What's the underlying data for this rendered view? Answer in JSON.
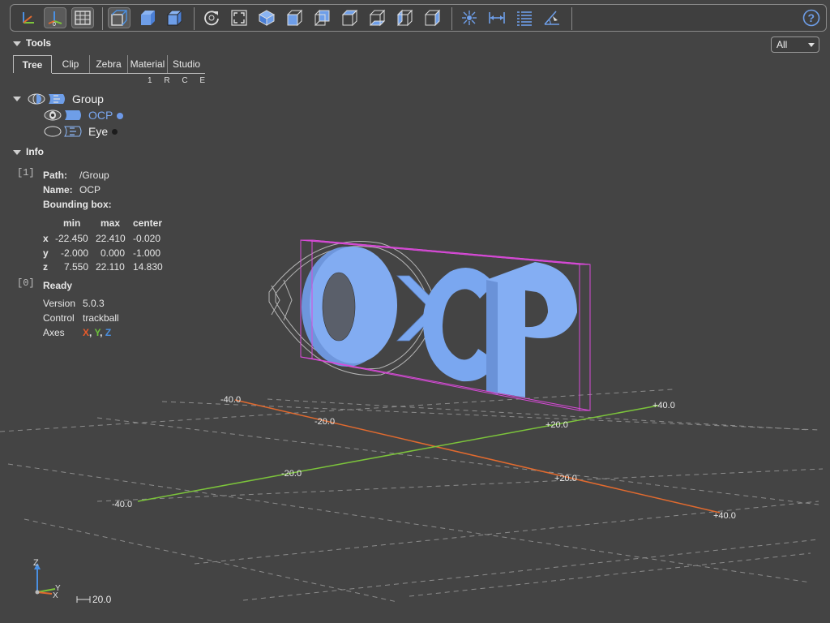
{
  "toolbar": {
    "buttons": [
      {
        "icon": "axes-icon",
        "active": false
      },
      {
        "icon": "axes-origin-icon",
        "active": true
      },
      {
        "icon": "grid-icon",
        "active": true
      },
      {
        "icon": "perspective-icon",
        "active": true
      },
      {
        "icon": "transparent-icon",
        "active": false
      },
      {
        "icon": "black-edges-icon",
        "active": false
      },
      {
        "icon": "reset-view-icon",
        "active": false
      },
      {
        "icon": "resize-icon",
        "active": false
      },
      {
        "icon": "view-iso-icon",
        "active": false
      },
      {
        "icon": "view-front-icon",
        "active": false
      },
      {
        "icon": "view-rear-icon",
        "active": false
      },
      {
        "icon": "view-top-icon",
        "active": false
      },
      {
        "icon": "view-bottom-icon",
        "active": false
      },
      {
        "icon": "view-left-icon",
        "active": false
      },
      {
        "icon": "view-right-icon",
        "active": false
      },
      {
        "icon": "explode-icon",
        "active": false
      },
      {
        "icon": "distance-measure-icon",
        "active": false
      },
      {
        "icon": "properties-icon",
        "active": false
      },
      {
        "icon": "angle-measure-icon",
        "active": false
      }
    ],
    "help_icon": "help-icon"
  },
  "view_select": {
    "value": "All"
  },
  "tools": {
    "title": "Tools",
    "tabs": [
      "Tree",
      "Clip",
      "Zebra",
      "Material",
      "Studio"
    ],
    "tree_columns": "1 R C E",
    "tree": [
      {
        "label": "Group",
        "level": 0
      },
      {
        "label": "OCP",
        "level": 1,
        "color": "#6d99e8"
      },
      {
        "label": "Eye",
        "level": 1,
        "color": "#1c1c1c"
      }
    ]
  },
  "info": {
    "title": "Info",
    "index1": "[1]",
    "path_label": "Path:",
    "path_value": "/Group",
    "name_label": "Name:",
    "name_value": "OCP",
    "bbox_label": "Bounding box:",
    "bbox_headers": [
      "min",
      "max",
      "center"
    ],
    "bbox_rows": [
      {
        "axis": "x",
        "min": "-22.450",
        "max": "22.410",
        "center": "-0.020"
      },
      {
        "axis": "y",
        "min": "-2.000",
        "max": "0.000",
        "center": "-1.000"
      },
      {
        "axis": "z",
        "min": "7.550",
        "max": "22.110",
        "center": "14.830"
      }
    ],
    "index0": "[0]",
    "status": "Ready",
    "version_label": "Version",
    "version_value": "5.0.3",
    "control_label": "Control",
    "control_value": "trackball",
    "axes_label": "Axes",
    "axes_x": "X",
    "axes_y": "Y",
    "axes_z": "Z",
    "sep1": ",",
    "sep2": ","
  },
  "scene": {
    "model_text": "OCP",
    "model_color": "#7aa7f0",
    "bbox_color": "#d94ad9",
    "x_axis_color": "#e06a2f",
    "y_axis_color": "#7cc43b",
    "grid_labels": {
      "x_m40": "-40.0",
      "x_m20": "-20.0",
      "x_p20": "+20.0",
      "x_p40": "+40.0",
      "y_m40": "-40.0",
      "y_m20": "-20.0",
      "y_p20": "+20.0",
      "y_p40": "+40.0"
    },
    "triad": {
      "x": "X",
      "y": "Y",
      "z": "Z"
    },
    "scale": "20.0"
  }
}
